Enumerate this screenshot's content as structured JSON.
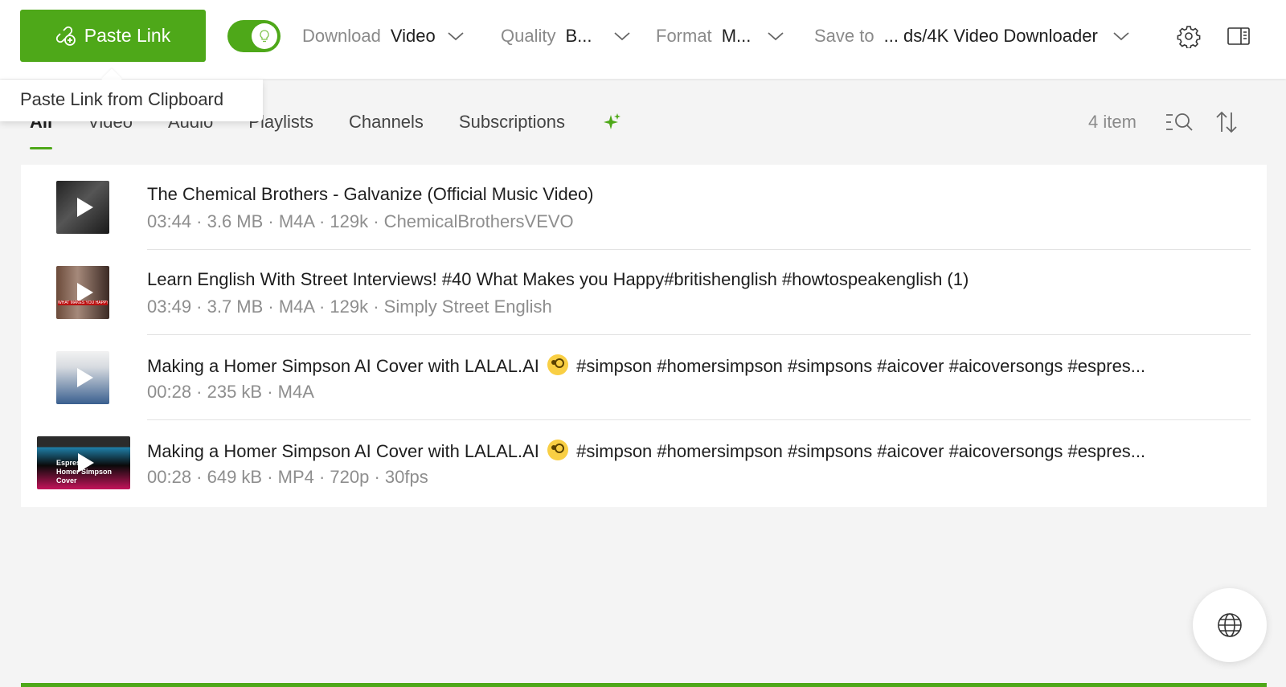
{
  "toolbar": {
    "paste_label": "Paste Link",
    "smart_mode_on": true,
    "download": {
      "label": "Download",
      "value": "Video"
    },
    "quality": {
      "label": "Quality",
      "value": "B..."
    },
    "format": {
      "label": "Format",
      "value": "M..."
    },
    "save_to": {
      "label": "Save to",
      "value": "... ds/4K Video Downloader"
    }
  },
  "tooltip": "Paste Link from Clipboard",
  "tabs": [
    "All",
    "Video",
    "Audio",
    "Playlists",
    "Channels",
    "Subscriptions"
  ],
  "active_tab": "All",
  "item_count": "4 item",
  "items": [
    {
      "title": "The Chemical Brothers - Galvanize (Official Music Video)",
      "title_after_emoji": "",
      "meta": "03:44 · 3.6 MB · M4A · 129k · ChemicalBrothersVEVO"
    },
    {
      "title": "Learn English With Street Interviews! #40 What Makes you Happy#britishenglish #howtospeakenglish (1)",
      "title_after_emoji": "",
      "meta": "03:49 · 3.7 MB · M4A · 129k · Simply Street English"
    },
    {
      "title": "Making a Homer Simpson AI Cover with LALAL.AI",
      "title_after_emoji": "#simpson #homersimpson #simpsons #aicover #aicoversongs #espres...",
      "meta": "00:28 · 235 kB · M4A"
    },
    {
      "title": "Making a Homer Simpson AI Cover with LALAL.AI",
      "title_after_emoji": "#simpson #homersimpson #simpsons #aicover #aicoversongs #espres...",
      "meta": "00:28 · 649 kB · MP4 · 720p · 30fps"
    }
  ],
  "thumbnail_text": {
    "item2": "WHAT MAKES YOU HAPPY",
    "item4": "Espresso Homer Simpson Cover"
  },
  "colors": {
    "accent": "#4ea819",
    "background": "#f4f4f4",
    "muted_text": "#8e8e8e"
  },
  "icons": [
    "paste-link-icon",
    "lightbulb-icon",
    "chevron-down-icon",
    "gear-icon",
    "sidebar-panel-icon",
    "sparkle-icon",
    "search-list-icon",
    "sort-icon",
    "globe-icon",
    "play-icon"
  ]
}
